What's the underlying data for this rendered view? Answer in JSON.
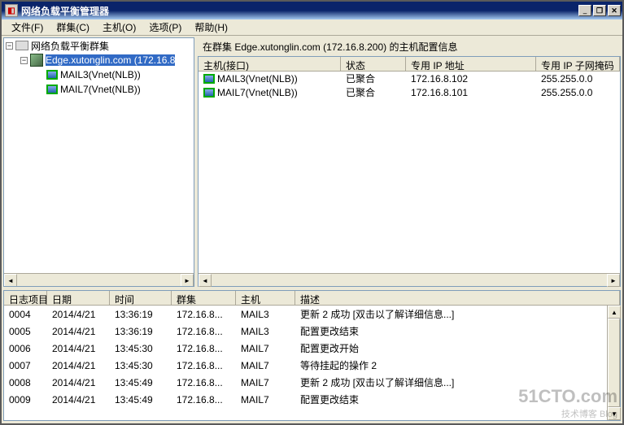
{
  "window": {
    "title": "网络负载平衡管理器",
    "min": "_",
    "restore": "❐",
    "close": "✕"
  },
  "menu": {
    "file": "文件(F)",
    "cluster": "群集(C)",
    "host": "主机(O)",
    "options": "选项(P)",
    "help": "帮助(H)"
  },
  "tree": {
    "root": "网络负载平衡群集",
    "cluster": "Edge.xutonglin.com (172.16.8",
    "host1": "MAIL3(Vnet(NLB))",
    "host2": "MAIL7(Vnet(NLB))"
  },
  "detail": {
    "caption": "在群集 Edge.xutonglin.com (172.16.8.200) 的主机配置信息",
    "columns": {
      "interface": "主机(接口)",
      "status": "状态",
      "ip": "专用 IP 地址",
      "mask": "专用 IP 子网掩码"
    },
    "rows": [
      {
        "interface": "MAIL3(Vnet(NLB))",
        "status": "已聚合",
        "ip": "172.16.8.102",
        "mask": "255.255.0.0"
      },
      {
        "interface": "MAIL7(Vnet(NLB))",
        "status": "已聚合",
        "ip": "172.16.8.101",
        "mask": "255.255.0.0"
      }
    ]
  },
  "log": {
    "columns": {
      "entry": "日志项目",
      "date": "日期",
      "time": "时间",
      "cluster": "群集",
      "host": "主机",
      "desc": "描述"
    },
    "rows": [
      {
        "entry": "0004",
        "date": "2014/4/21",
        "time": "13:36:19",
        "cluster": "172.16.8...",
        "host": "MAIL3",
        "desc": "更新 2 成功 [双击以了解详细信息...]"
      },
      {
        "entry": "0005",
        "date": "2014/4/21",
        "time": "13:36:19",
        "cluster": "172.16.8...",
        "host": "MAIL3",
        "desc": "配置更改结束"
      },
      {
        "entry": "0006",
        "date": "2014/4/21",
        "time": "13:45:30",
        "cluster": "172.16.8...",
        "host": "MAIL7",
        "desc": "配置更改开始"
      },
      {
        "entry": "0007",
        "date": "2014/4/21",
        "time": "13:45:30",
        "cluster": "172.16.8...",
        "host": "MAIL7",
        "desc": "等待挂起的操作 2"
      },
      {
        "entry": "0008",
        "date": "2014/4/21",
        "time": "13:45:49",
        "cluster": "172.16.8...",
        "host": "MAIL7",
        "desc": "更新 2 成功 [双击以了解详细信息...]"
      },
      {
        "entry": "0009",
        "date": "2014/4/21",
        "time": "13:45:49",
        "cluster": "172.16.8...",
        "host": "MAIL7",
        "desc": "配置更改结束"
      }
    ]
  },
  "watermark": {
    "main": "51CTO.com",
    "sub": "技术博客  Blog"
  }
}
